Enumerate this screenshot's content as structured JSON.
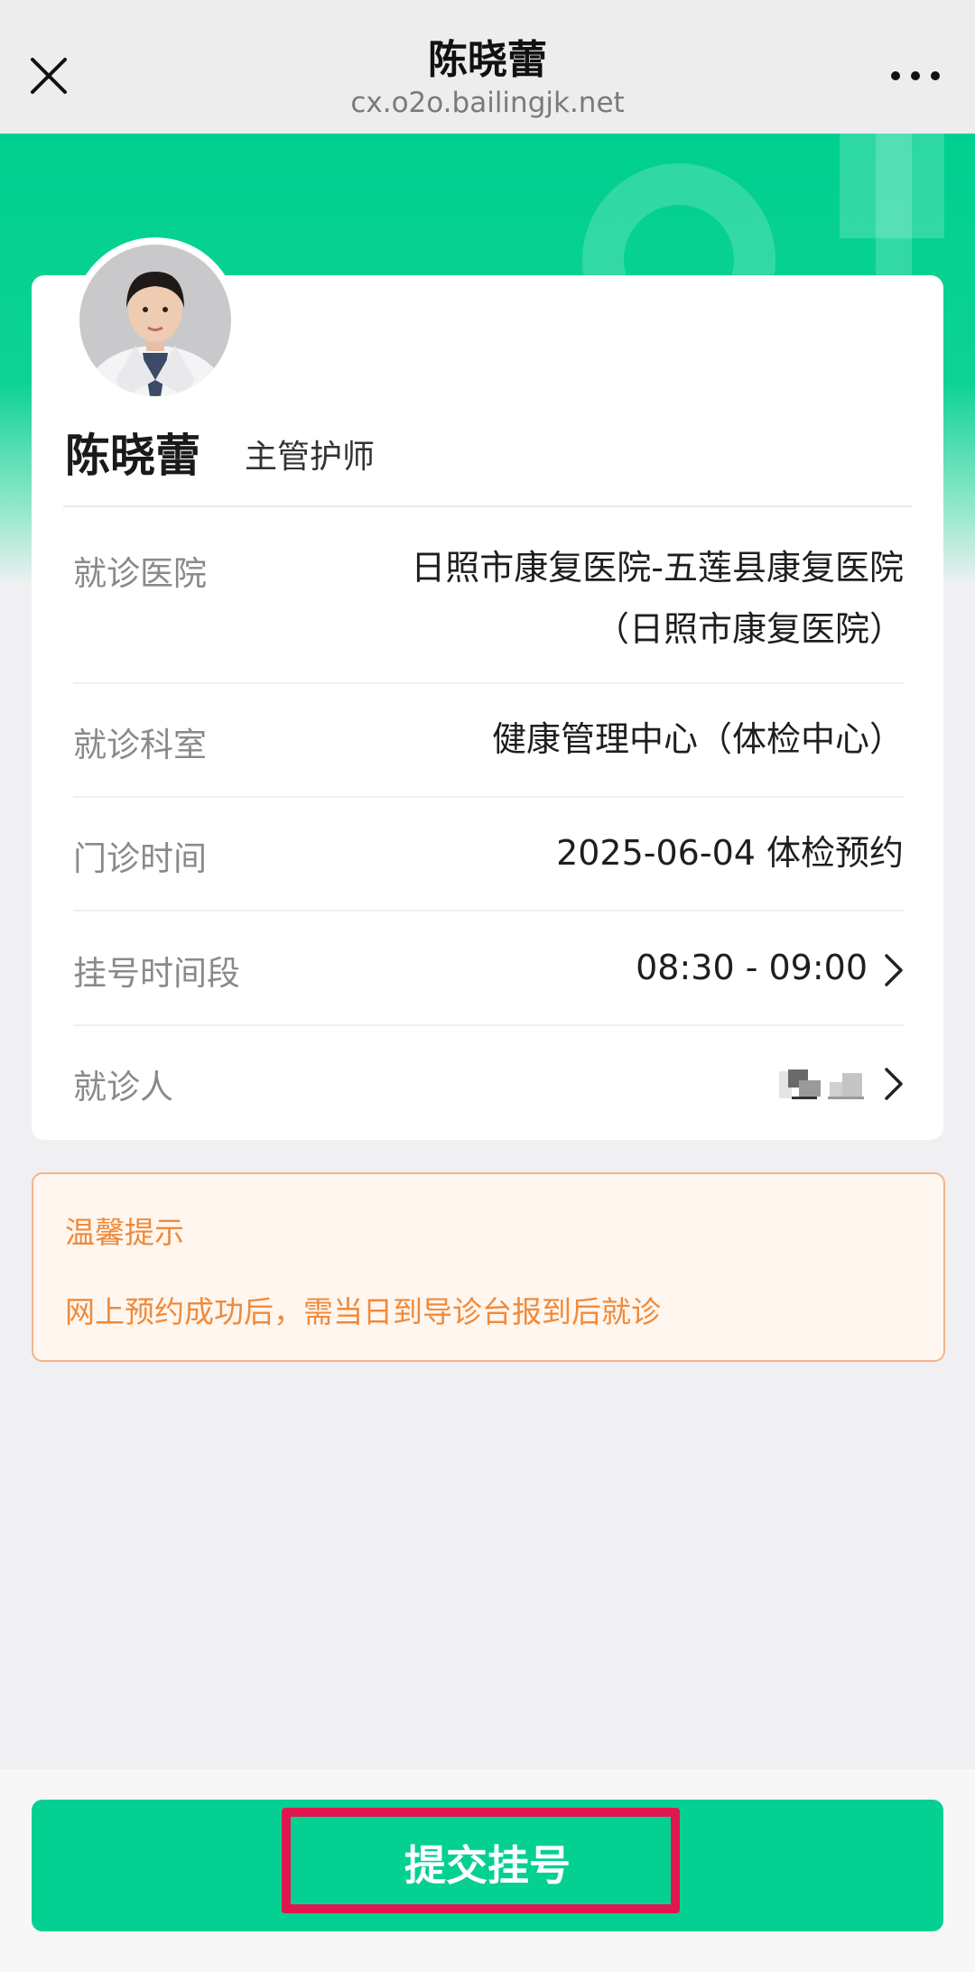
{
  "nav": {
    "title": "陈晓蕾",
    "url": "cx.o2o.bailingjk.net",
    "close_icon": "close-icon",
    "more_icon": "more-icon"
  },
  "doctor": {
    "name": "陈晓蕾",
    "title": "主管护师"
  },
  "info_rows": [
    {
      "label": "就诊医院",
      "value_line1": "日照市康复医院-五莲县康复医院",
      "value_line2": "（日照市康复医院）"
    },
    {
      "label": "就诊科室",
      "value": "健康管理中心（体检中心）"
    },
    {
      "label": "门诊时间",
      "value": "2025-06-04 体检预约"
    },
    {
      "label": "挂号时间段",
      "value": "08:30 - 09:00"
    },
    {
      "label": "就诊人",
      "value": ""
    }
  ],
  "tip": {
    "title": "温馨提示",
    "text": "网上预约成功后，需当日到导诊台报到后就诊"
  },
  "submit": {
    "label": "提交挂号"
  },
  "colors": {
    "brand_green": "#04d091",
    "tip_orange": "#f08a3a",
    "highlight_red": "#e0174f"
  }
}
